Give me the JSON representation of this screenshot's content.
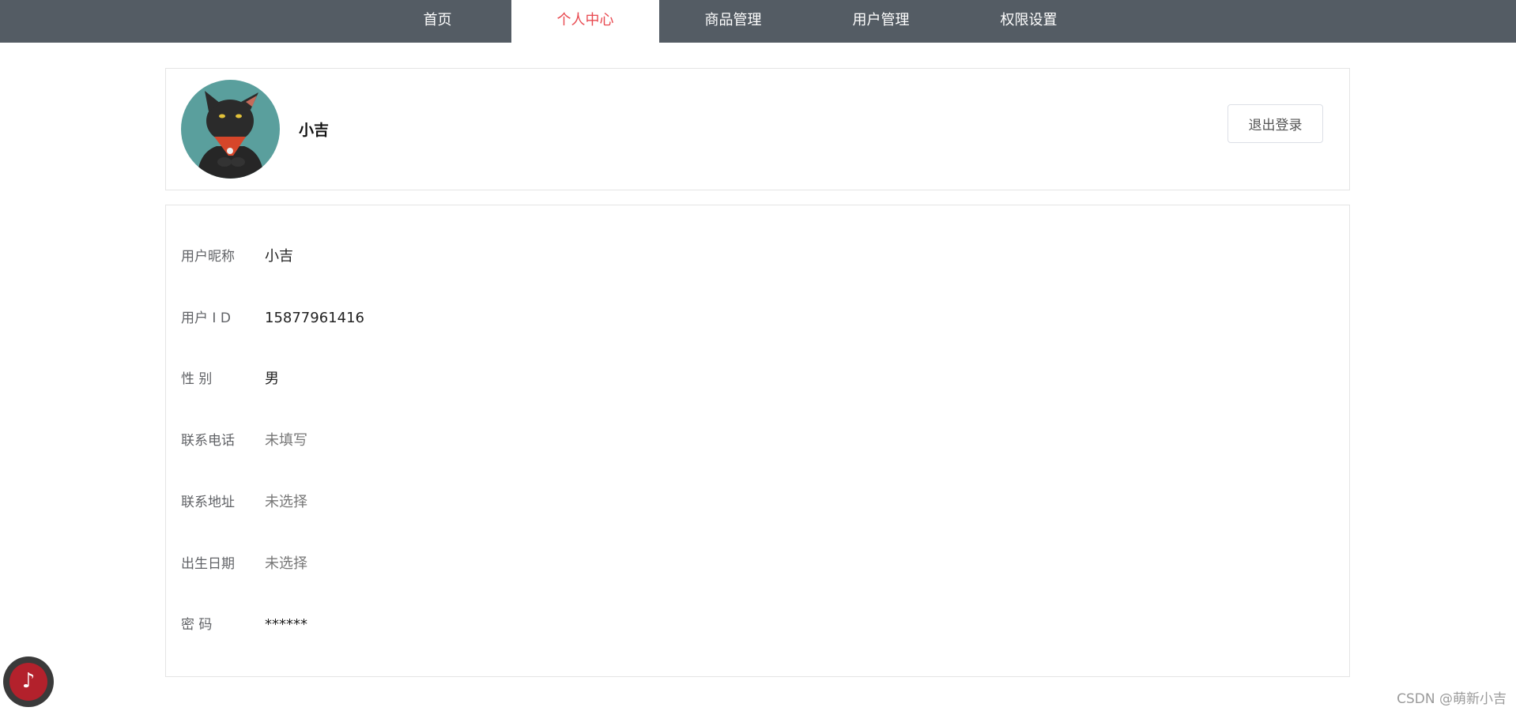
{
  "nav": {
    "items": [
      {
        "label": "首页",
        "active": false
      },
      {
        "label": "个人中心",
        "active": true
      },
      {
        "label": "商品管理",
        "active": false
      },
      {
        "label": "用户管理",
        "active": false
      },
      {
        "label": "权限设置",
        "active": false
      }
    ],
    "colors": {
      "background": "#545c64",
      "active_text": "#e8484f",
      "text": "#ffffff"
    }
  },
  "profile": {
    "avatar_icon": "black-cat-avatar",
    "name": "小吉",
    "logout_label": "退出登录"
  },
  "info": {
    "rows": [
      {
        "label": "用户昵称",
        "value": "小吉"
      },
      {
        "label": "用户 I D",
        "value": "15877961416"
      },
      {
        "label": "性 别",
        "value": "男"
      },
      {
        "label": "联系电话",
        "value": "未填写"
      },
      {
        "label": "联系地址",
        "value": "未选择"
      },
      {
        "label": "出生日期",
        "value": "未选择"
      },
      {
        "label": "密 码",
        "value": "******"
      }
    ]
  },
  "music_button": {
    "icon": "music-note-icon",
    "glyph": "♪"
  },
  "watermark": "CSDN @萌新小吉"
}
